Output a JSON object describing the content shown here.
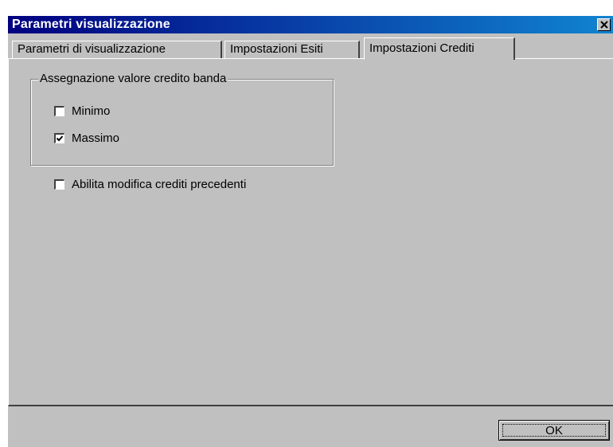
{
  "window": {
    "title": "Parametri visualizzazione"
  },
  "tabs": [
    {
      "label": "Parametri di visualizzazione",
      "active": false
    },
    {
      "label": "Impostazioni Esiti",
      "active": false
    },
    {
      "label": "Impostazioni Crediti",
      "active": true
    }
  ],
  "group": {
    "legend": "Assegnazione valore credito banda",
    "options": [
      {
        "label": "Minimo",
        "checked": false
      },
      {
        "label": "Massimo",
        "checked": true
      }
    ]
  },
  "extra_option": {
    "label": "Abilita modifica crediti precedenti",
    "checked": false
  },
  "buttons": {
    "ok_label": "OK"
  },
  "icons": {
    "close": "close-icon",
    "check": "checkmark-icon"
  },
  "colors": {
    "face": "#c0c0c0",
    "title_start": "#000080",
    "title_end": "#1084d0"
  }
}
